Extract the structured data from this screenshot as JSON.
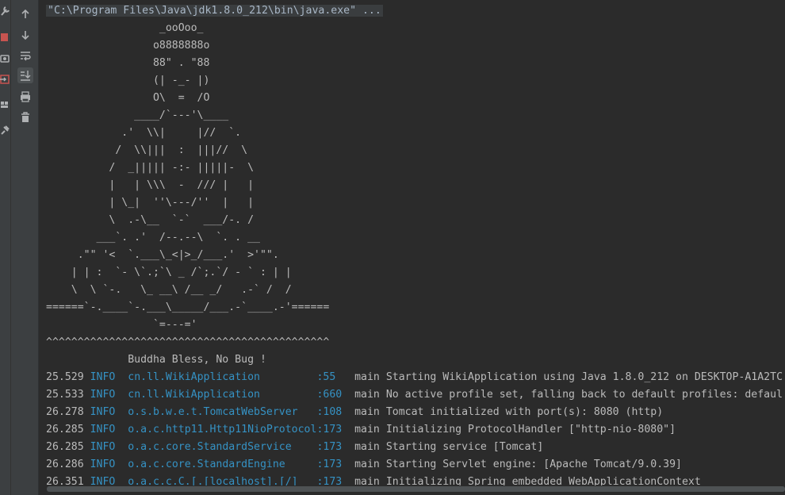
{
  "command_line": "\"C:\\Program Files\\Java\\jdk1.8.0_212\\bin\\java.exe\" ...",
  "banner": [
    "                  _ooOoo_",
    "                 o8888888o",
    "                 88\" . \"88",
    "                 (| -_- |)",
    "                 O\\  =  /O",
    "              ____/`---'\\____",
    "            .'  \\\\|     |//  `.",
    "           /  \\\\|||  :  |||//  \\",
    "          /  _||||| -:- |||||-  \\",
    "          |   | \\\\\\  -  /// |   |",
    "          | \\_|  ''\\---/''  |   |",
    "          \\  .-\\__  `-`  ___/-. /",
    "        ___`. .'  /--.--\\  `. . __",
    "     .\"\" '<  `.___\\_<|>_/___.'  >'\"\".",
    "    | | :  `- \\`.;`\\ _ /`;.`/ - ` : | |",
    "    \\  \\ `-.   \\_ __\\ /__ _/   .-` /  /",
    "======`-.____`-.___\\_____/___.-`____.-'======",
    "                 `=---='",
    "^^^^^^^^^^^^^^^^^^^^^^^^^^^^^^^^^^^^^^^^^^^^^",
    "             Buddha Bless, No Bug !"
  ],
  "logs": [
    {
      "time": "25.529",
      "level": "INFO",
      "logger": "cn.ll.WikiApplication         ",
      "line": ":55  ",
      "thread": "main",
      "msg": "Starting WikiApplication using Java 1.8.0_212 on DESKTOP-A1A2TC"
    },
    {
      "time": "25.533",
      "level": "INFO",
      "logger": "cn.ll.WikiApplication         ",
      "line": ":660 ",
      "thread": "main",
      "msg": "No active profile set, falling back to default profiles: defaul"
    },
    {
      "time": "26.278",
      "level": "INFO",
      "logger": "o.s.b.w.e.t.TomcatWebServer   ",
      "line": ":108 ",
      "thread": "main",
      "msg": "Tomcat initialized with port(s): 8080 (http)"
    },
    {
      "time": "26.285",
      "level": "INFO",
      "logger": "o.a.c.http11.Http11NioProtocol",
      "line": ":173 ",
      "thread": "main",
      "msg": "Initializing ProtocolHandler [\"http-nio-8080\"]"
    },
    {
      "time": "26.285",
      "level": "INFO",
      "logger": "o.a.c.core.StandardService    ",
      "line": ":173 ",
      "thread": "main",
      "msg": "Starting service [Tomcat]"
    },
    {
      "time": "26.286",
      "level": "INFO",
      "logger": "o.a.c.core.StandardEngine     ",
      "line": ":173 ",
      "thread": "main",
      "msg": "Starting Servlet engine: [Apache Tomcat/9.0.39]"
    },
    {
      "time": "26.351",
      "level": "INFO",
      "logger": "o.a.c.c.C.[.[localhost].[/]   ",
      "line": ":173 ",
      "thread": "main",
      "msg": "Initializing Spring embedded WebApplicationContext"
    }
  ],
  "colors": {
    "background": "#2b2b2b",
    "text": "#bbbbbb",
    "logger_blue": "#3592c4",
    "stop_red": "#c75450"
  },
  "left_strip_icons": [
    "wrench-icon",
    "stop-icon",
    "camera-icon",
    "exit-icon",
    "layout-icon",
    "pin-icon"
  ],
  "toolbar_icons": [
    "arrow-up-icon",
    "arrow-down-icon",
    "soft-wrap-icon",
    "scroll-to-end-icon",
    "print-icon",
    "trash-icon"
  ]
}
